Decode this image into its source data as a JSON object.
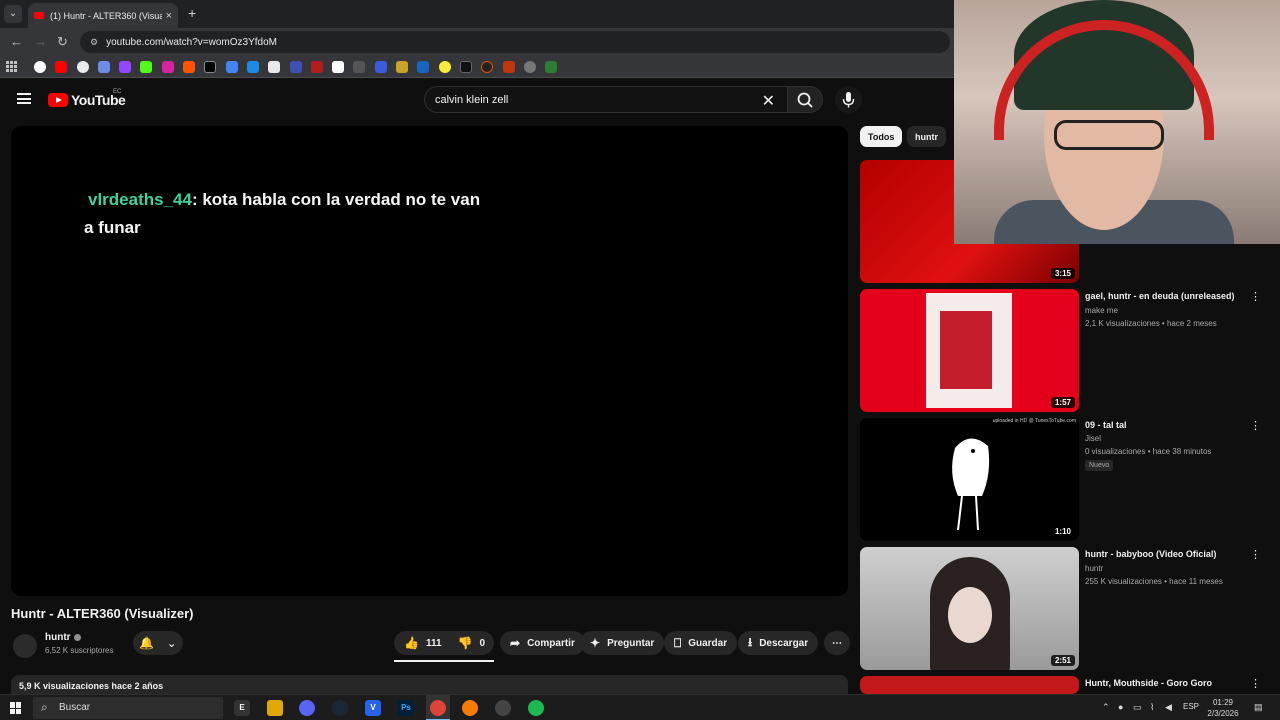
{
  "browser": {
    "tab_title": "(1) Huntr - ALTER360 (Visualizer)",
    "url": "youtube.com/watch?v=womOz3YfdoM"
  },
  "youtube": {
    "logo_text": "YouTube",
    "country_code": "EC",
    "search_query": "calvin klein zell"
  },
  "player": {
    "chat_user": "vlrdeaths_44",
    "chat_text": ": kota habla con la verdad no te van a funar"
  },
  "video": {
    "title": "Huntr - ALTER360 (Visualizer)",
    "channel": "huntr",
    "subscribers": "6,52 K suscriptores",
    "likes": "111",
    "dislikes": "0",
    "share_label": "Compartir",
    "ask_label": "Preguntar",
    "save_label": "Guardar",
    "download_label": "Descargar",
    "views_date": "5,9 K visualizaciones  hace 2 años"
  },
  "chips": [
    "Todos",
    "huntr"
  ],
  "related": [
    {
      "title": "",
      "channel": "",
      "meta": "",
      "duration": "3:15"
    },
    {
      "title": "gael, huntr - en deuda (unreleased)",
      "channel": "make me",
      "meta": "2,1 K visualizaciones • hace 2 meses",
      "duration": "1:57"
    },
    {
      "title": "09 - tal tal",
      "channel": "Jisel",
      "meta": "0 visualizaciones • hace 38 minutos",
      "badge": "Nuevo",
      "duration": "1:10",
      "thumb_caption": "uploaded in HD @ TunesToTube.com"
    },
    {
      "title": "huntr - babyboo (Video Oficial)",
      "channel": "huntr",
      "meta": "255 K visualizaciones • hace 11 meses",
      "duration": "2:51"
    },
    {
      "title": "Huntr, Mouthside - Goro Goro",
      "channel": "",
      "meta": "",
      "duration": ""
    }
  ],
  "taskbar": {
    "search_label": "Buscar",
    "language": "ESP",
    "time": "01:29",
    "date": "2/3/2026"
  },
  "colors": {
    "youtube_red": "#ff0000",
    "chat_username": "#3fd29f",
    "background": "#0f0f0f"
  }
}
